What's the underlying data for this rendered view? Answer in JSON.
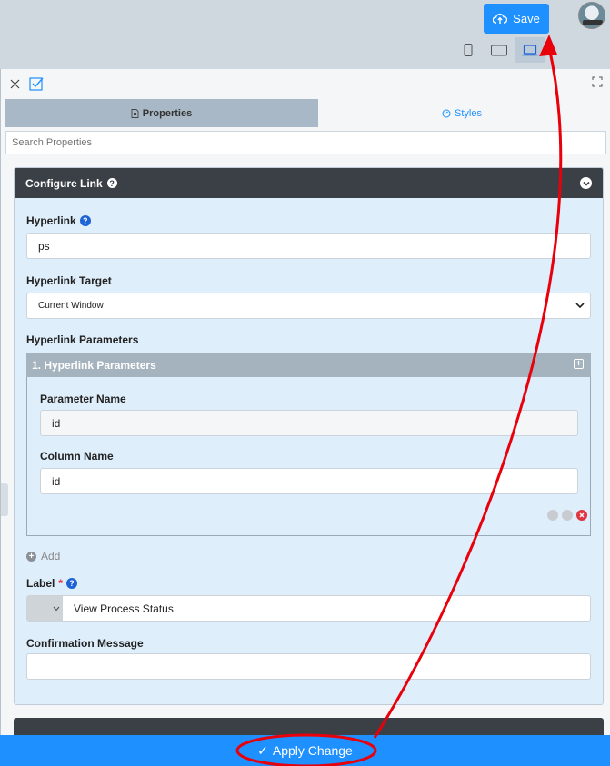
{
  "topbar": {
    "save_label": "Save"
  },
  "panel": {
    "tabs": [
      {
        "label": "Properties",
        "active": true
      },
      {
        "label": "Styles",
        "active": false
      }
    ],
    "search_placeholder": "Search Properties"
  },
  "configure_link": {
    "title": "Configure Link",
    "hyperlink_label": "Hyperlink",
    "hyperlink_value": "ps",
    "target_label": "Hyperlink Target",
    "target_value": "Current Window",
    "params_label": "Hyperlink Parameters",
    "params_item_title": "1. Hyperlink Parameters",
    "param_name_label": "Parameter Name",
    "param_name_value": "id",
    "column_name_label": "Column Name",
    "column_name_value": "id",
    "add_label": "Add",
    "label_label": "Label",
    "required_mark": "*",
    "label_value": "View Process Status",
    "confirm_label": "Confirmation Message",
    "confirm_value": ""
  },
  "footer": {
    "apply_label": "Apply Change",
    "apply_check": "✓"
  },
  "colors": {
    "accent": "#1e90ff",
    "annotation": "#e8000b",
    "section_header": "#3a4046",
    "panel_bg": "#dfeefb"
  }
}
